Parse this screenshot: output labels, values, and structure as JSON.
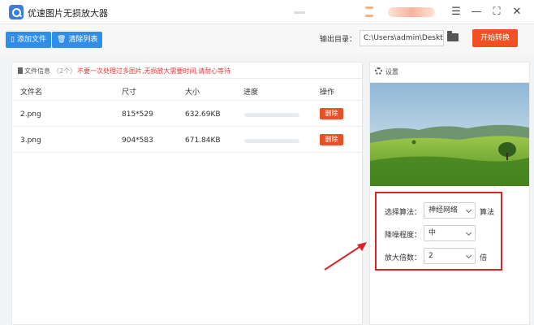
{
  "window": {
    "title": "优速图片无损放大器"
  },
  "toolbar": {
    "add_file": "添加文件",
    "clear_list": "清除列表",
    "output_label": "输出目录：",
    "output_path": "C:\\Users\\admin\\Deskto",
    "start": "开始转换"
  },
  "file_panel": {
    "info_label": "文件信息",
    "count": "（2个）",
    "warning": "不要一次处理过多图片,无损放大需要时间,请耐心等待",
    "columns": {
      "name": "文件名",
      "size": "尺寸",
      "filesize": "大小",
      "progress": "进度",
      "action": "操作"
    },
    "rows": [
      {
        "name": "2.png",
        "dimensions": "815*529",
        "filesize": "632.69KB",
        "progress": 0,
        "action": "删除"
      },
      {
        "name": "3.png",
        "dimensions": "904*583",
        "filesize": "671.84KB",
        "progress": 0,
        "action": "删除"
      }
    ]
  },
  "settings": {
    "label": "设置",
    "algorithm_label": "选择算法：",
    "algorithm_value": "神经网络",
    "algorithm_suffix": "算法",
    "denoise_label": "降噪程度：",
    "denoise_value": "中",
    "scale_label": "放大倍数：",
    "scale_value": "2",
    "scale_suffix": "倍"
  },
  "colors": {
    "primary": "#2f8fe8",
    "accent": "#f05023",
    "highlight": "#d9252a"
  },
  "icons": {
    "app": "magnifier-icon",
    "add": "file-icon",
    "clear": "trash-icon",
    "folder": "folder-icon",
    "settings": "gear-icon"
  }
}
